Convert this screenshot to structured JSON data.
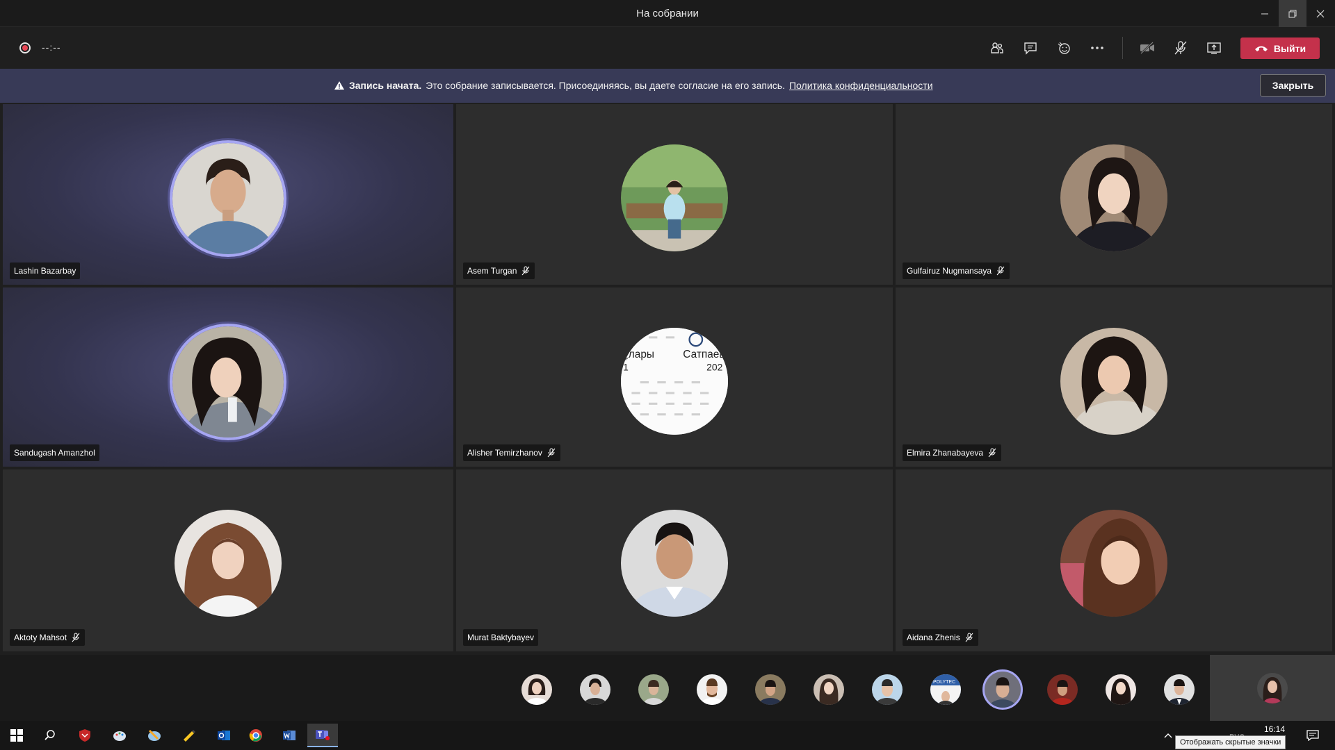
{
  "window": {
    "title": "На собрании"
  },
  "toolbar": {
    "timer": "--:--",
    "leave_label": "Выйти"
  },
  "banner": {
    "title": "Запись начата.",
    "message": "Это собрание записывается. Присоединяясь, вы даете согласие на его запись.",
    "link": "Политика конфиденциальности",
    "close_label": "Закрыть"
  },
  "participants": [
    {
      "name": "Lashin Bazarbay",
      "muted": false,
      "speaking": true
    },
    {
      "name": "Asem Turgan",
      "muted": true,
      "speaking": false
    },
    {
      "name": "Gulfairuz Nugmansaya",
      "muted": true,
      "speaking": false
    },
    {
      "name": "Sandugash Amanzhol",
      "muted": false,
      "speaking": true
    },
    {
      "name": "Alisher Temirzhanov",
      "muted": true,
      "speaking": false
    },
    {
      "name": "Elmira Zhanabayeva",
      "muted": true,
      "speaking": false
    },
    {
      "name": "Aktoty Mahsot",
      "muted": true,
      "speaking": false
    },
    {
      "name": "Murat Baktybayev",
      "muted": false,
      "speaking": false
    },
    {
      "name": "Aidana Zhenis",
      "muted": true,
      "speaking": false
    }
  ],
  "alisher_avatar_text": {
    "left": "ұлары",
    "right": "Сатпаевс",
    "num_left": "1",
    "num_right": "202"
  },
  "strip_thumb_text": "POLYTEC",
  "taskbar": {
    "time": "16:14",
    "lang": "РУС",
    "tooltip": "Отображать скрытые значки"
  },
  "colors": {
    "accent": "#a6a6f2",
    "leave": "#c4314b",
    "banner": "#383a57"
  }
}
